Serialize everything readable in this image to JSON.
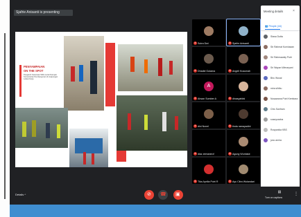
{
  "presenting_banner": "Sjafrie Anisanti is presenting",
  "slide": {
    "heading_line1": "PENYAMPAIAN",
    "heading_line2": "ON THE SPOT",
    "body": "Pengaruh Ketentuan WFH serta Petunjuk Kementerian Pembangunan di Lingkungan Lokasi Kerja"
  },
  "tiles": [
    {
      "name": "Sutra Dwi",
      "avatar_color": "#9e7b63"
    },
    {
      "name": "Sjafrie Anisanti",
      "avatar_color": "#8fb2c9"
    },
    {
      "name": "Dhadid Gutama",
      "avatar_color": "#6b5a4d"
    },
    {
      "name": "Angeli Kusumah",
      "avatar_color": "#7a6152"
    },
    {
      "name": "Ahsan Sumber A",
      "avatar_color": "#c2185b"
    },
    {
      "name": "dinasyahfai",
      "avatar_color": "#d7b59b"
    },
    {
      "name": "dini Novel",
      "avatar_color": "#7c5f49"
    },
    {
      "name": "tinda ramayadini",
      "avatar_color": "#4e3b30"
    },
    {
      "name": "diaz ahmanirof",
      "avatar_color": "#202124"
    },
    {
      "name": "Agung Wuntalut",
      "avatar_color": "#aa8b73"
    },
    {
      "name": "Tika Aprilia Putri R",
      "avatar_color": "#d32f2f"
    },
    {
      "name": "Ayu Citra Wulandari",
      "avatar_color": "#a08a70"
    }
  ],
  "panel": {
    "title": "Meeting details",
    "tab_people": "People (44)",
    "tab_chat": "",
    "items": [
      {
        "name": "Stasa Dutta",
        "color": "#5f6368"
      },
      {
        "name": "Sb Rahmat Kurniawan",
        "color": "#8d6e63"
      },
      {
        "name": "Sri Rahmawaty Putri",
        "color": "#a1887f"
      },
      {
        "name": "Sri Wayan Wimaryani",
        "color": "#ab47bc"
      },
      {
        "name": "Biru Wusal",
        "color": "#5c6bc0"
      },
      {
        "name": "mira sihibu",
        "color": "#8d6e63"
      },
      {
        "name": "Nusaarana Putri Kembara",
        "color": "#795548"
      },
      {
        "name": "Chis Sanfram",
        "color": "#607d8b"
      },
      {
        "name": "snanyoseba",
        "color": "#9e9e9e"
      },
      {
        "name": "Ruspanika KBS",
        "color": "#bdbdbd"
      },
      {
        "name": "juno amira",
        "color": "#7e57c2"
      }
    ],
    "footer": "Turn on captions"
  },
  "ctrl": {
    "details_label": "Details ^"
  },
  "colors": {
    "accent": "#1a73e8",
    "red": "#ea4335",
    "band": "#3f8ed0"
  }
}
